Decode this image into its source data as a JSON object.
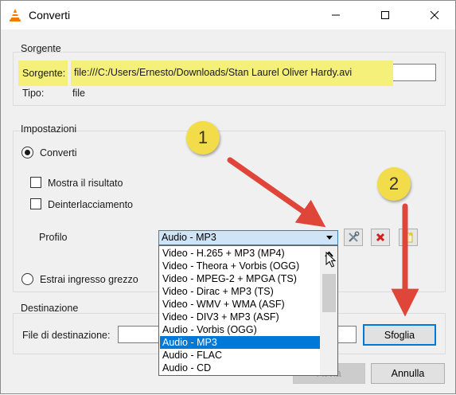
{
  "window": {
    "title": "Converti",
    "icon": "vlc-cone-icon",
    "controls": [
      "minimize-icon",
      "maximize-icon",
      "close-icon"
    ]
  },
  "source": {
    "group_title": "Sorgente",
    "source_label": "Sorgente:",
    "source_value": "file:///C:/Users/Ernesto/Downloads/Stan Laurel  Oliver Hardy.avi",
    "type_label": "Tipo:",
    "type_value": "file",
    "highlight_color": "#f4f07a"
  },
  "settings": {
    "group_title": "Impostazioni",
    "convert_radio": {
      "label": "Converti",
      "checked": true
    },
    "show_output_checkbox": {
      "label": "Mostra il risultato",
      "checked": false
    },
    "deinterlace_checkbox": {
      "label": "Deinterlacciamento",
      "checked": false
    },
    "profile_label": "Profilo",
    "profile_selected": "Audio - MP3",
    "raw_input_radio": {
      "label": "Estrai ingresso grezzo",
      "checked": false
    },
    "profile_tools": [
      "wrench-icon",
      "delete-red-x-icon",
      "new-profile-icon"
    ]
  },
  "profile_dropdown": {
    "options": [
      "Video - H.265 + MP3 (MP4)",
      "Video - Theora + Vorbis (OGG)",
      "Video - MPEG-2 + MPGA (TS)",
      "Video - Dirac + MP3 (TS)",
      "Video - WMV + WMA (ASF)",
      "Video - DIV3 + MP3 (ASF)",
      "Audio - Vorbis (OGG)",
      "Audio - MP3",
      "Audio - FLAC",
      "Audio - CD"
    ],
    "selected_index": 7,
    "selection_color": "#0078d7"
  },
  "destination": {
    "group_title": "Destinazione",
    "file_label": "File di destinazione:",
    "file_value": "",
    "browse_button": "Sfoglia"
  },
  "footer": {
    "start_button": "Avvia",
    "cancel_button": "Annulla"
  },
  "annotations": {
    "badges": [
      "1",
      "2"
    ],
    "badge_color": "#f2dc49",
    "arrow_color": "#e0453a"
  }
}
